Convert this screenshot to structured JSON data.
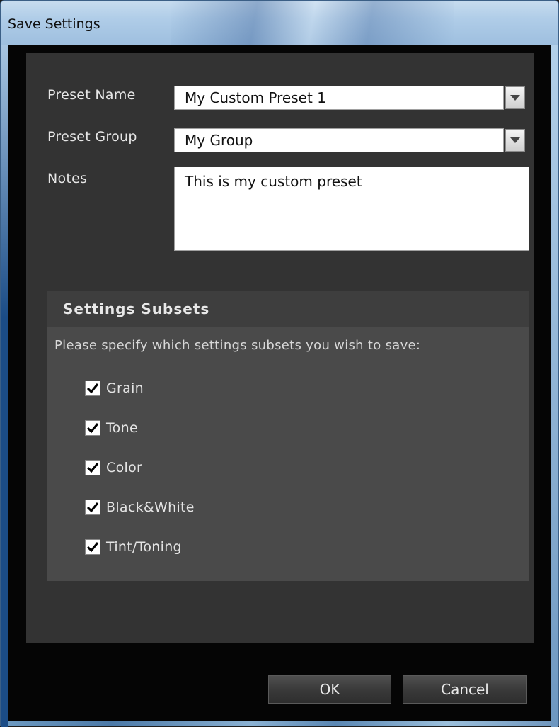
{
  "window": {
    "title": "Save Settings"
  },
  "form": {
    "preset_name": {
      "label": "Preset Name",
      "value": "My Custom Preset 1"
    },
    "preset_group": {
      "label": "Preset Group",
      "value": "My Group"
    },
    "notes": {
      "label": "Notes",
      "value": "This is my custom preset"
    }
  },
  "subsets": {
    "title": "Settings Subsets",
    "description": "Please specify which settings subsets you wish to save:",
    "items": [
      {
        "label": "Grain",
        "checked": true
      },
      {
        "label": "Tone",
        "checked": true
      },
      {
        "label": "Color",
        "checked": true
      },
      {
        "label": "Black&White",
        "checked": true
      },
      {
        "label": "Tint/Toning",
        "checked": true
      }
    ]
  },
  "buttons": {
    "ok": "OK",
    "cancel": "Cancel"
  },
  "icons": {
    "combo": "chevron-down-icon",
    "check": "checkmark-icon"
  }
}
